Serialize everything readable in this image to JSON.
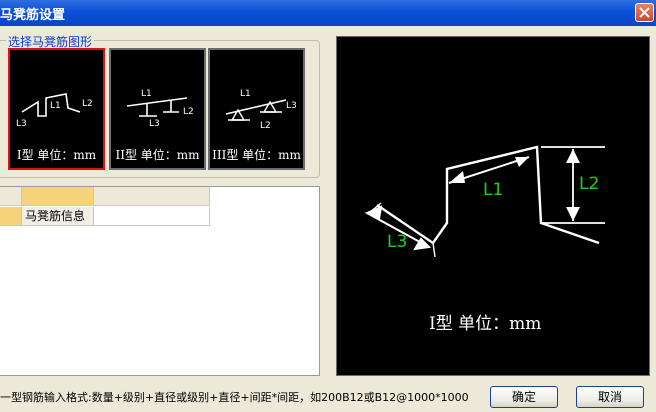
{
  "window": {
    "title": "马凳筋设置",
    "close_icon": "close-icon"
  },
  "shape_group": {
    "label": "选择马凳筋图形",
    "shapes": [
      {
        "caption": "I型 单位：mm",
        "labels": [
          "L1",
          "L2",
          "L3"
        ],
        "selected": true
      },
      {
        "caption": "II型 单位：mm",
        "labels": [
          "L1",
          "L2",
          "L3"
        ],
        "selected": false
      },
      {
        "caption": "III型 单位：mm",
        "labels": [
          "L1",
          "L2",
          "L3"
        ],
        "selected": false
      }
    ]
  },
  "grid": {
    "rows": [
      {
        "label": "马凳筋信息",
        "value": ""
      }
    ]
  },
  "preview": {
    "labels": {
      "l1": "L1",
      "l2": "L2",
      "l3": "L3"
    },
    "caption": "I型 单位：mm",
    "label_color": "#22cc22"
  },
  "footer": {
    "hint": "一型钢筋输入格式:数量+级别+直径或级别+直径+间距*间距，如200B12或B12@1000*1000",
    "ok_label": "确定",
    "cancel_label": "取消"
  }
}
